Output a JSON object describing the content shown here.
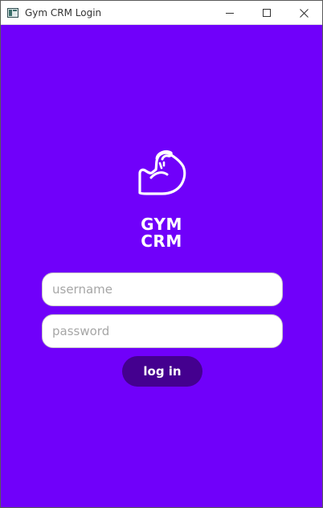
{
  "window": {
    "title": "Gym CRM Login",
    "icon": "app-window-icon",
    "controls": [
      "minimize-icon",
      "maximize-icon",
      "close-icon"
    ]
  },
  "colors": {
    "background": "#7000fa",
    "button": "#44008f",
    "field": "#ffffff",
    "text_light": "#ffffff"
  },
  "brand": {
    "logo_icon": "flexed-bicep-icon",
    "line1": "GYM",
    "line2": "CRM"
  },
  "form": {
    "username": {
      "value": "",
      "placeholder": "username"
    },
    "password": {
      "value": "",
      "placeholder": "password"
    },
    "login_label": "log in"
  }
}
